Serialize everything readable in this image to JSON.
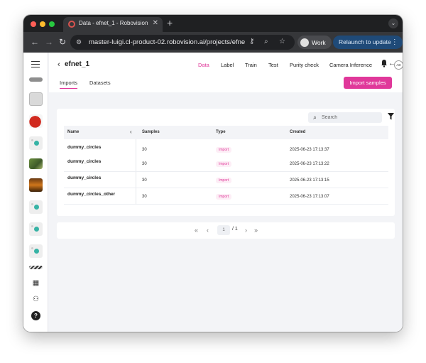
{
  "browser": {
    "tab_title": "Data - efnet_1 - Robovision #",
    "url": "master-luigi.cl-product-02.robovision.ai/projects/efne...",
    "profile_label": "Work",
    "relaunch_label": "Relaunch to update"
  },
  "header": {
    "project_title": "efnet_1",
    "nav_tabs": [
      "Data",
      "Label",
      "Train",
      "Test",
      "Purity check",
      "Camera Inference"
    ],
    "active_tab": "Data",
    "user_initials": "AD"
  },
  "subtabs": [
    "Imports",
    "Datasets"
  ],
  "import_button_label": "Import samples",
  "search": {
    "placeholder": "Search"
  },
  "table": {
    "columns": [
      "Name",
      "Samples",
      "Type",
      "Created"
    ],
    "rows": [
      {
        "name": "dummy_circles",
        "samples": "30",
        "type": "Import",
        "created": "2025-06-23 17:13:37"
      },
      {
        "name": "dummy_circles",
        "samples": "30",
        "type": "Import",
        "created": "2025-06-23 17:13:22"
      },
      {
        "name": "dummy_circles",
        "samples": "30",
        "type": "Import",
        "created": "2025-06-23 17:13:15"
      },
      {
        "name": "dummy_circles_other",
        "samples": "30",
        "type": "Import",
        "created": "2025-06-23 17:13:07"
      }
    ]
  },
  "pagination": {
    "current": "1",
    "total": "/ 1"
  },
  "colors": {
    "accent": "#e0389a",
    "background": "#f3f4f7"
  }
}
